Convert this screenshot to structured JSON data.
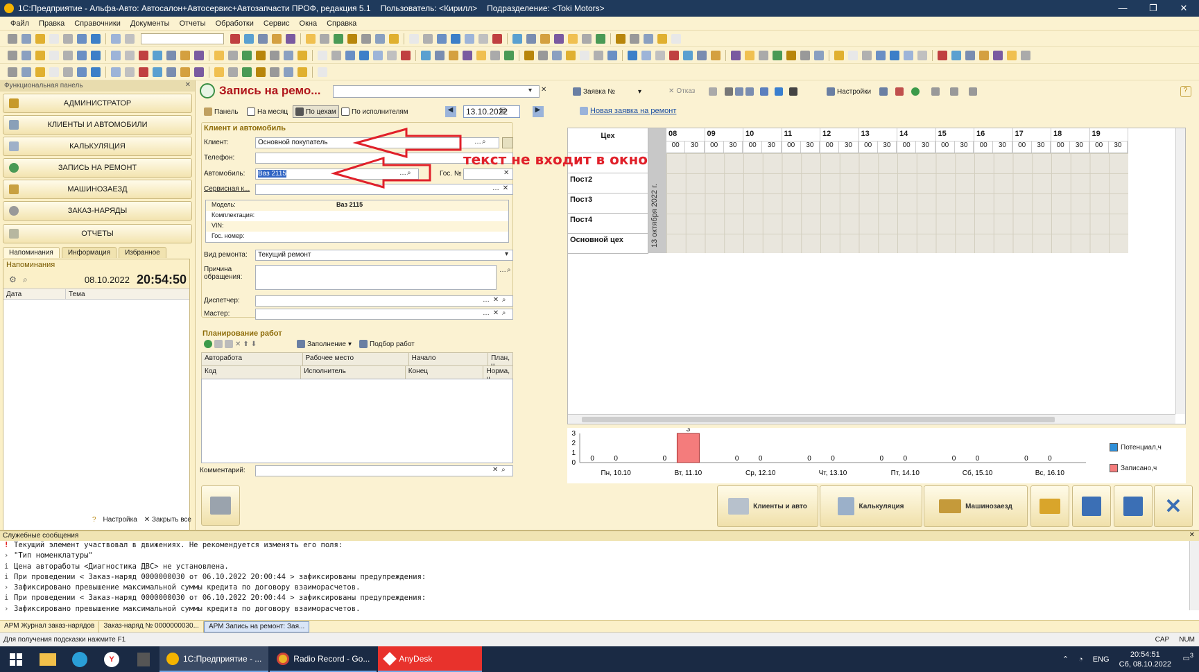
{
  "window": {
    "title_parts": [
      "1С:Предприятие - Альфа-Авто: Автосалон+Автосервис+Автозапчасти ПРОФ, редакция 5.1",
      "Пользователь: <Кирилл>",
      "Подразделение: <Toki Motors>"
    ],
    "controls": [
      "—",
      "❐",
      "✕"
    ]
  },
  "menu": [
    "Файл",
    "Правка",
    "Справочники",
    "Документы",
    "Отчеты",
    "Обработки",
    "Сервис",
    "Окна",
    "Справка"
  ],
  "left_panel": {
    "header": "Функциональная панель",
    "nav": [
      "АДМИНИСТРАТОР",
      "КЛИЕНТЫ И АВТОМОБИЛИ",
      "КАЛЬКУЛЯЦИЯ",
      "ЗАПИСЬ НА РЕМОНТ",
      "МАШИНОЗАЕЗД",
      "ЗАКАЗ-НАРЯДЫ",
      "ОТЧЕТЫ"
    ],
    "tabs": [
      "Напоминания",
      "Информация",
      "Избранное"
    ],
    "reminders_title": "Напоминания",
    "date": "08.10.2022",
    "time": "20:54:50",
    "columns": [
      "Дата",
      "Тема"
    ],
    "footer": [
      "Настройка",
      "Закрыть все"
    ]
  },
  "form": {
    "title": "Запись на ремо...",
    "toolbar": {
      "order": "Заявка №",
      "refuse": "Отказ",
      "settings": "Настройки"
    },
    "views": [
      "Панель",
      "На месяц",
      "По цехам",
      "По исполнителям"
    ],
    "date": "13.10.2022",
    "new_link": "Новая заявка на ремонт",
    "section_client": "Клиент и автомобиль",
    "labels": {
      "client": "Клиент:",
      "phone": "Телефон:",
      "car": "Автомобиль:",
      "plate": "Гос. №",
      "service_card": "Сервисная к...",
      "repair_type": "Вид ремонта:",
      "reason": "Причина обращения:",
      "dispatcher": "Диспетчер:",
      "master": "Мастер:",
      "comment": "Комментарий:"
    },
    "values": {
      "client": "Основной покупатель",
      "car": "Ваз 2115",
      "repair_type": "Текущий ремонт"
    },
    "car_info": [
      [
        "Модель:",
        "Ваз 2115"
      ],
      [
        "Комплектация:",
        ""
      ],
      [
        "VIN:",
        ""
      ],
      [
        "Гос. номер:",
        ""
      ]
    ],
    "section_planning": "Планирование работ",
    "plan_buttons": {
      "fill": "Заполнение",
      "pick": "Подбор работ"
    },
    "grid_head1": [
      "Авторабота",
      "Рабочее место",
      "Начало",
      "План, ч"
    ],
    "grid_head2": [
      "Код",
      "Исполнитель",
      "Конец",
      "Норма, ч"
    ]
  },
  "schedule": {
    "col_header": "Цех",
    "posts": [
      "",
      "Пост2",
      "Пост3",
      "Пост4",
      "Основной цех"
    ],
    "date_vertical": "13 октября 2022 г.",
    "hours": [
      "08",
      "09",
      "10",
      "11",
      "12",
      "13",
      "14",
      "15",
      "16",
      "17",
      "18",
      "19"
    ],
    "minutes": [
      "00",
      "30"
    ]
  },
  "chart_data": {
    "type": "bar",
    "categories": [
      "Пн, 10.10",
      "Вт, 11.10",
      "Ср, 12.10",
      "Чт, 13.10",
      "Пт, 14.10",
      "Сб, 15.10",
      "Вс, 16.10"
    ],
    "series": [
      {
        "name": "Потенциал,ч",
        "values": [
          0,
          0,
          0,
          0,
          0,
          0,
          0
        ],
        "color": "#2f8fd8"
      },
      {
        "name": "Записано,ч",
        "values": [
          0,
          3,
          0,
          0,
          0,
          0,
          0
        ],
        "color": "#f47c7c"
      }
    ],
    "yticks": [
      "0",
      "1",
      "2",
      "3"
    ],
    "ylim": [
      0,
      3
    ]
  },
  "bottom_buttons": [
    "Клиенты и авто",
    "Калькуляция",
    "Машинозаезд"
  ],
  "messages": {
    "title": "Служебные сообщения",
    "lines": [
      {
        "mark": "!",
        "text": "Текущий элемент участвовал в движениях. Не рекомендуется изменять его поля:"
      },
      {
        "mark": "›",
        "text": "\"Тип номенклатуры\""
      },
      {
        "mark": "i",
        "text": "Цена автоработы <Диагностика ДВС> не установлена."
      },
      {
        "mark": "i",
        "text": "При проведении < Заказ-наряд 0000000030 от 06.10.2022 20:00:44 > зафиксированы предупреждения:"
      },
      {
        "mark": "›",
        "text": "Зафиксировано превышение максимальной суммы кредита по договору взаиморасчетов."
      },
      {
        "mark": "i",
        "text": "При проведении < Заказ-наряд 0000000030 от 06.10.2022 20:00:44 > зафиксированы предупреждения:"
      },
      {
        "mark": "›",
        "text": "Зафиксировано превышение максимальной суммы кредита по договору взаиморасчетов."
      }
    ]
  },
  "window_tabs": [
    "АРМ Журнал заказ-нарядов",
    "Заказ-наряд № 0000000030...",
    "АРМ Запись на ремонт: Зая..."
  ],
  "status": {
    "hint": "Для получения подсказки нажмите F1",
    "caps": "CAP",
    "num": "NUM"
  },
  "taskbar": {
    "apps": [
      "1С:Предприятие - ...",
      "Radio Record - Go...",
      "AnyDesk"
    ],
    "lang": "ENG",
    "time": "20:54:51",
    "date": "Сб, 08.10.2022",
    "notif": "3"
  },
  "annotation": "текст не входит в окно"
}
